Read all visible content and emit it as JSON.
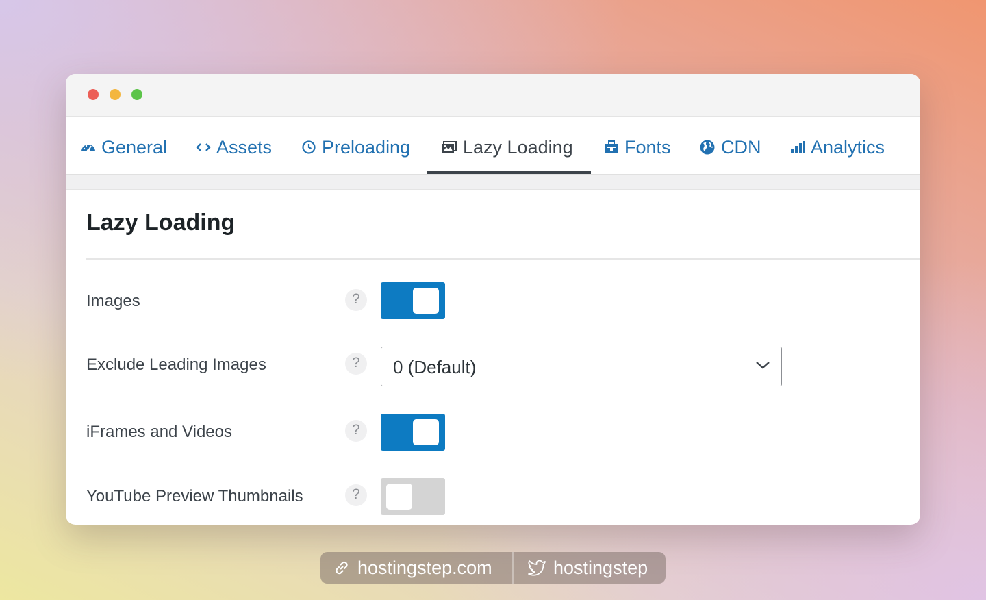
{
  "tabs": [
    {
      "label": "General",
      "icon": "dashboard-icon",
      "active": false
    },
    {
      "label": "Assets",
      "icon": "code-icon",
      "active": false
    },
    {
      "label": "Preloading",
      "icon": "clock-icon",
      "active": false
    },
    {
      "label": "Lazy Loading",
      "icon": "image-icon",
      "active": true
    },
    {
      "label": "Fonts",
      "icon": "briefcase-icon",
      "active": false
    },
    {
      "label": "CDN",
      "icon": "globe-icon",
      "active": false
    },
    {
      "label": "Analytics",
      "icon": "bar-chart-icon",
      "active": false
    }
  ],
  "section": {
    "title": "Lazy Loading"
  },
  "settings": [
    {
      "label": "Images",
      "help": "?",
      "type": "toggle",
      "enabled": true
    },
    {
      "label": "Exclude Leading Images",
      "help": "?",
      "type": "select",
      "value": "0 (Default)"
    },
    {
      "label": "iFrames and Videos",
      "help": "?",
      "type": "toggle",
      "enabled": true
    },
    {
      "label": "YouTube Preview Thumbnails",
      "help": "?",
      "type": "toggle",
      "enabled": false
    }
  ],
  "footer": {
    "website": "hostingstep.com",
    "twitter": "hostingstep"
  },
  "colors": {
    "link": "#2271b1",
    "toggle_on": "#0d7bc2",
    "toggle_off": "#d4d4d4",
    "text": "#3c434a"
  }
}
